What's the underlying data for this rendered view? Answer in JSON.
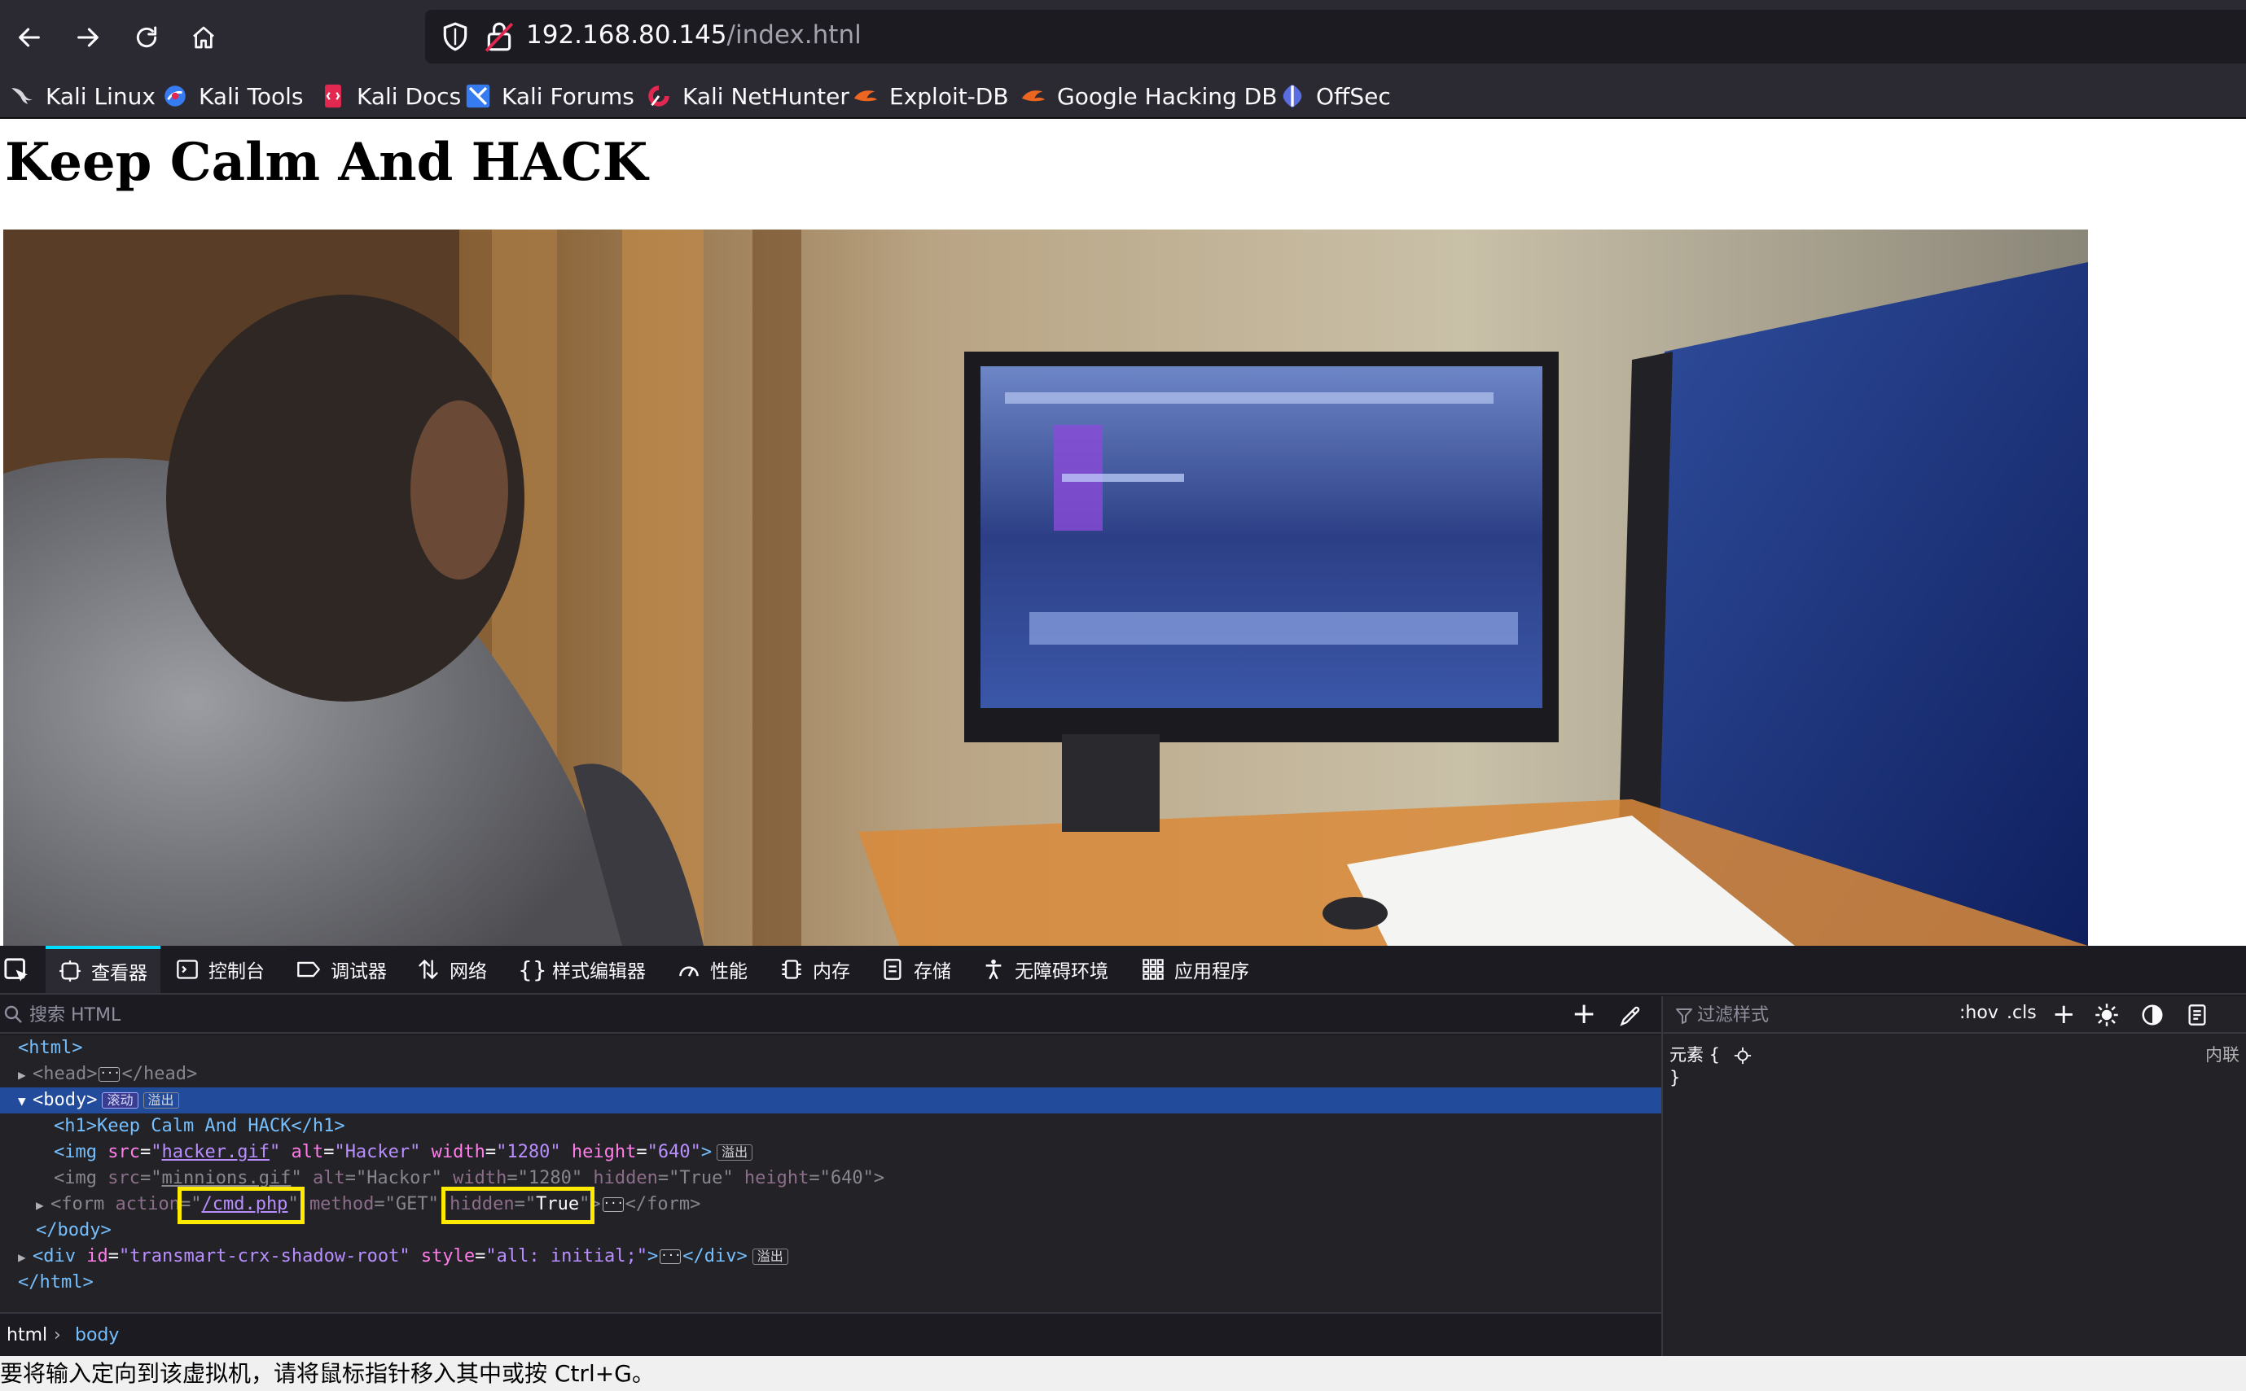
{
  "browser": {
    "url_host": "192.168.80.145",
    "url_path": "/index.htnl",
    "bookmarks": [
      {
        "label": "Kali Linux",
        "icon": "kali-dragon-icon"
      },
      {
        "label": "Kali Tools",
        "icon": "kali-tools-icon"
      },
      {
        "label": "Kali Docs",
        "icon": "kali-docs-icon"
      },
      {
        "label": "Kali Forums",
        "icon": "kali-forums-icon"
      },
      {
        "label": "Kali NetHunter",
        "icon": "nethunter-icon"
      },
      {
        "label": "Exploit-DB",
        "icon": "exploit-db-icon"
      },
      {
        "label": "Google Hacking DB",
        "icon": "ghdb-icon"
      },
      {
        "label": "OffSec",
        "icon": "offsec-icon"
      }
    ]
  },
  "page": {
    "heading": "Keep Calm And HACK"
  },
  "devtools": {
    "tabs": [
      {
        "label": "查看器",
        "icon": "inspector-icon",
        "active": true
      },
      {
        "label": "控制台",
        "icon": "console-icon"
      },
      {
        "label": "调试器",
        "icon": "debugger-icon"
      },
      {
        "label": "网络",
        "icon": "network-icon"
      },
      {
        "label": "样式编辑器",
        "icon": "style-editor-icon"
      },
      {
        "label": "性能",
        "icon": "performance-icon"
      },
      {
        "label": "内存",
        "icon": "memory-icon"
      },
      {
        "label": "存储",
        "icon": "storage-icon"
      },
      {
        "label": "无障碍环境",
        "icon": "accessibility-icon"
      },
      {
        "label": "应用程序",
        "icon": "application-icon"
      }
    ],
    "search_placeholder": "搜索 HTML",
    "filter_placeholder": "过滤样式",
    "hov": ":hov",
    "cls": ".cls",
    "rules": {
      "element_label": "元素 {",
      "close_brace": "}",
      "inline_label": "内联"
    },
    "tree": {
      "html_open": "<html>",
      "head_open": "<head>",
      "head_close": "</head>",
      "body_open": "<body>",
      "badge_scroll": "滚动",
      "badge_overflow": "溢出",
      "h1_line": "<h1>Keep Calm And HACK</h1>",
      "img1": {
        "src": "hacker.gif",
        "alt": "Hacker",
        "width": "1280",
        "height": "640"
      },
      "img2": {
        "src": "minnions.gif",
        "alt": "Hackor",
        "width": "1280",
        "hidden": "True",
        "height": "640"
      },
      "form": {
        "action": "/cmd.php",
        "method": "GET",
        "hidden": "True"
      },
      "form_close": "</form>",
      "body_close": "</body>",
      "div": {
        "id": "transmart-crx-shadow-root",
        "style": "all: initial;"
      },
      "div_close": "</div>",
      "html_close": "</html>"
    },
    "breadcrumbs": [
      "html",
      "body"
    ]
  },
  "statusbar": {
    "text": "要将输入定向到该虚拟机，请将鼠标指针移入其中或按 Ctrl+G。"
  }
}
